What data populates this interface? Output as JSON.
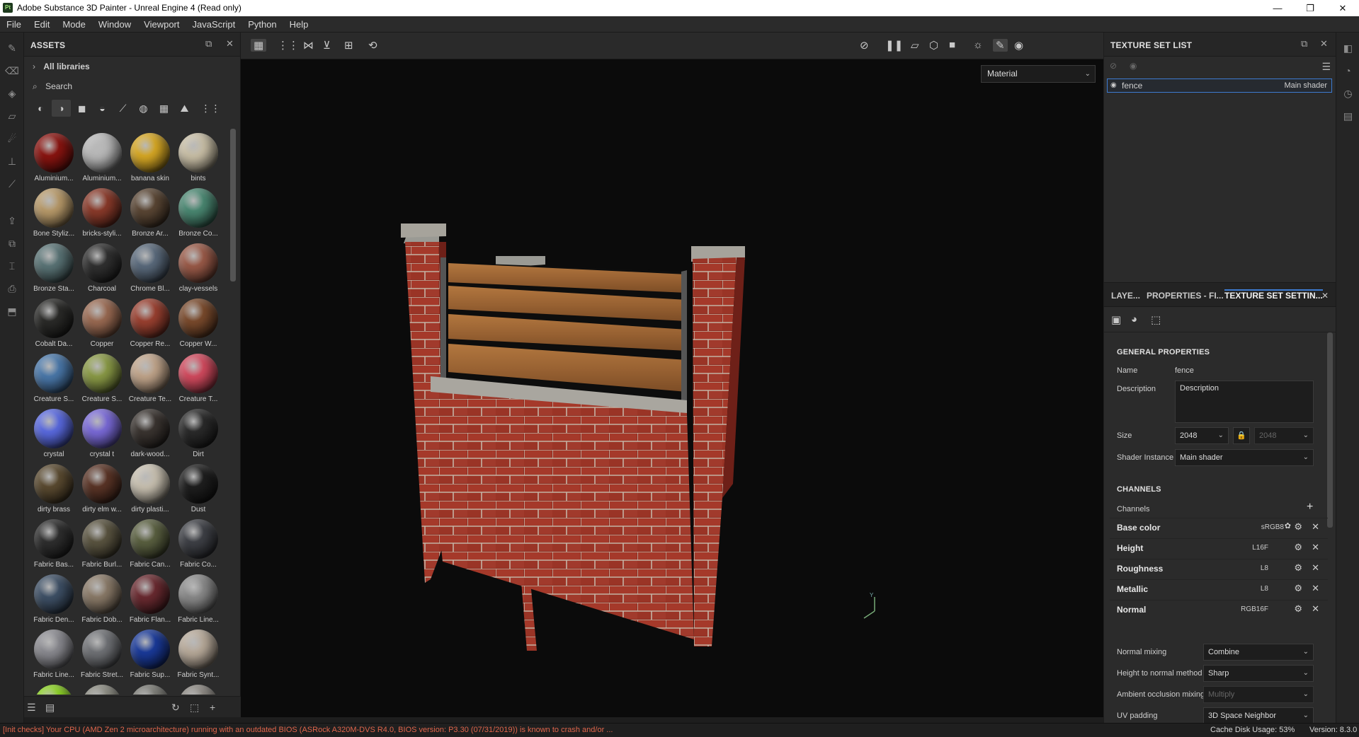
{
  "window": {
    "app_icon": "Pt",
    "title": "Adobe Substance 3D Painter - Unreal Engine 4 (Read only)",
    "minimize": "—",
    "restore": "❐",
    "close": "✕"
  },
  "menu": [
    "File",
    "Edit",
    "Mode",
    "Window",
    "Viewport",
    "JavaScript",
    "Python",
    "Help"
  ],
  "assets": {
    "title": "ASSETS",
    "library": "All libraries",
    "search_placeholder": "Search",
    "items": [
      {
        "label": "Aluminium...",
        "color": "#8a1410"
      },
      {
        "label": "Aluminium...",
        "color": "#b8b8b8"
      },
      {
        "label": "banana skin",
        "color": "#d7a824"
      },
      {
        "label": "bints",
        "color": "#c9bfa6"
      },
      {
        "label": "Bone Styliz...",
        "color": "#b89a6a"
      },
      {
        "label": "bricks-styli...",
        "color": "#8a3a2a"
      },
      {
        "label": "Bronze Ar...",
        "color": "#5a4634"
      },
      {
        "label": "Bronze Co...",
        "color": "#4a8872"
      },
      {
        "label": "Bronze Sta...",
        "color": "#5a7476"
      },
      {
        "label": "Charcoal",
        "color": "#303030"
      },
      {
        "label": "Chrome Bl...",
        "color": "#5a6a7c"
      },
      {
        "label": "clay-vessels",
        "color": "#9a5a48"
      },
      {
        "label": "Cobalt Da...",
        "color": "#2a2a28"
      },
      {
        "label": "Copper",
        "color": "#9a6a52"
      },
      {
        "label": "Copper Re...",
        "color": "#9a4030"
      },
      {
        "label": "Copper W...",
        "color": "#7a4a2c"
      },
      {
        "label": "Creature S...",
        "color": "#4a78aa"
      },
      {
        "label": "Creature S...",
        "color": "#8a9a46"
      },
      {
        "label": "Creature Te...",
        "color": "#c0a48a"
      },
      {
        "label": "Creature T...",
        "color": "#d24a5e"
      },
      {
        "label": "crystal",
        "color": "#5a6ae0"
      },
      {
        "label": "crystal t",
        "color": "#7a6ad8"
      },
      {
        "label": "dark-wood...",
        "color": "#3a3430"
      },
      {
        "label": "Dirt",
        "color": "#2a2a2a"
      },
      {
        "label": "dirty brass",
        "color": "#5a4a30"
      },
      {
        "label": "dirty elm w...",
        "color": "#5a3426"
      },
      {
        "label": "dirty plasti...",
        "color": "#c8c0b0"
      },
      {
        "label": "Dust",
        "color": "#1e1e1e"
      },
      {
        "label": "Fabric Bas...",
        "color": "#2e2e2e"
      },
      {
        "label": "Fabric Burl...",
        "color": "#5a5440"
      },
      {
        "label": "Fabric Can...",
        "color": "#5a6040"
      },
      {
        "label": "Fabric Co...",
        "color": "#3e4046"
      },
      {
        "label": "Fabric Den...",
        "color": "#3e5066"
      },
      {
        "label": "Fabric Dob...",
        "color": "#8a7a68"
      },
      {
        "label": "Fabric Flan...",
        "color": "#6a2a30"
      },
      {
        "label": "Fabric Line...",
        "color": "#8a8a8a"
      },
      {
        "label": "Fabric Line...",
        "color": "#8a8a90"
      },
      {
        "label": "Fabric Stret...",
        "color": "#707276"
      },
      {
        "label": "Fabric Sup...",
        "color": "#1a3a9a"
      },
      {
        "label": "Fabric Synt...",
        "color": "#b8aa9a"
      },
      {
        "label": "",
        "color": "#8ad220"
      },
      {
        "label": "",
        "color": "#8a8a80"
      },
      {
        "label": "",
        "color": "#7a7a74"
      },
      {
        "label": "",
        "color": "#8a8680"
      }
    ]
  },
  "viewport": {
    "mode_select": "Material"
  },
  "texture_set_list": {
    "title": "TEXTURE SET LIST",
    "item_name": "fence",
    "item_shader": "Main shader"
  },
  "tabs": [
    "LAYE...",
    "PROPERTIES - FI...",
    "TEXTURE SET SETTIN..."
  ],
  "settings": {
    "general_title": "GENERAL PROPERTIES",
    "name_label": "Name",
    "name_value": "fence",
    "description_label": "Description",
    "description_value": "Description",
    "size_label": "Size",
    "size_value": "2048",
    "size_value2": "2048",
    "shader_label": "Shader Instance",
    "shader_value": "Main shader",
    "channels_title": "CHANNELS",
    "channels_label": "Channels",
    "channels": [
      {
        "name": "Base color",
        "format": "sRGB8"
      },
      {
        "name": "Height",
        "format": "L16F"
      },
      {
        "name": "Roughness",
        "format": "L8"
      },
      {
        "name": "Metallic",
        "format": "L8"
      },
      {
        "name": "Normal",
        "format": "RGB16F"
      }
    ],
    "normal_mixing_label": "Normal mixing",
    "normal_mixing_value": "Combine",
    "height_normal_label": "Height to normal method",
    "height_normal_value": "Sharp",
    "ao_mixing_label": "Ambient occlusion mixing",
    "ao_mixing_value": "Multiply",
    "uv_padding_label": "UV padding",
    "uv_padding_value": "3D Space Neighbor"
  },
  "status": {
    "error": "[Init checks] Your CPU (AMD Zen 2 microarchitecture) running with an outdated BIOS (ASRock A320M-DVS R4.0, BIOS version: P3.30 (07/31/2019)) is known to crash and/or ...",
    "cache": "Cache Disk Usage:  53%",
    "version": "Version: 8.3.0"
  }
}
